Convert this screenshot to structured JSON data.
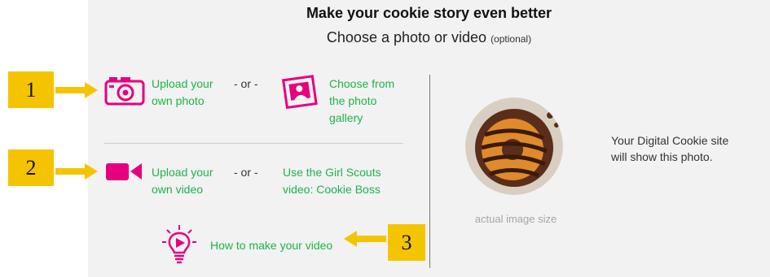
{
  "header": {
    "title": "Make your cookie story even better",
    "subtitle": "Choose a photo or video",
    "subtitle_optional": "(optional)"
  },
  "photo": {
    "upload_label_line1": "Upload your",
    "upload_label_line2": "own photo",
    "or": "- or -",
    "gallery_label_line1": "Choose from",
    "gallery_label_line2": "the photo",
    "gallery_label_line3": "gallery"
  },
  "video": {
    "upload_label_line1": "Upload your",
    "upload_label_line2": "own video",
    "or": "- or -",
    "gs_video_label_line1": "Use the Girl Scouts",
    "gs_video_label_line2": "video: Cookie Boss"
  },
  "howto": {
    "label": "How to make your video"
  },
  "preview": {
    "caption": "actual image size",
    "info_line1": "Your Digital Cookie site",
    "info_line2": "will show this photo."
  },
  "callouts": [
    "1",
    "2",
    "3"
  ],
  "colors": {
    "link": "#1fb24a",
    "icon": "#e6007e",
    "callout": "#f5c400",
    "panel": "#f2f2f2"
  },
  "icons": [
    "camera-icon",
    "photo-gallery-icon",
    "video-camera-icon",
    "lightbulb-play-icon",
    "arrow-right-icon",
    "arrow-left-icon"
  ]
}
